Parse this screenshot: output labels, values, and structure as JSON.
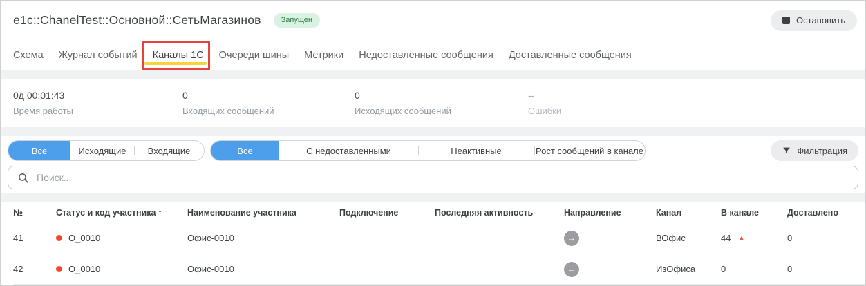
{
  "header": {
    "title": "e1c::ChanelTest::Основной::СетьМагазинов",
    "status_badge": "Запущен",
    "stop_button": "Остановить"
  },
  "tabs": [
    {
      "label": "Схема",
      "active": false
    },
    {
      "label": "Журнал событий",
      "active": false
    },
    {
      "label": "Каналы 1С",
      "active": true,
      "annotated": true
    },
    {
      "label": "Очереди шины",
      "active": false
    },
    {
      "label": "Метрики",
      "active": false
    },
    {
      "label": "Недоставленные сообщения",
      "active": false
    },
    {
      "label": "Доставленные сообщения",
      "active": false
    }
  ],
  "stats": [
    {
      "value": "0д 00:01:43",
      "label": "Время работы"
    },
    {
      "value": "0",
      "label": "Входящих сообщений"
    },
    {
      "value": "0",
      "label": "Исходящих сообщений"
    },
    {
      "value": "--",
      "label": "Ошибки",
      "muted": true
    }
  ],
  "filters": {
    "direction_segments": [
      "Все",
      "Исходящие",
      "Входящие"
    ],
    "direction_selected": "Все",
    "status_segments": [
      "Все",
      "С недоставленными",
      "Неактивные",
      "Рост сообщений в канале"
    ],
    "status_selected": "Все",
    "filter_button": "Фильтрация"
  },
  "search": {
    "placeholder": "Поиск...",
    "value": ""
  },
  "table": {
    "columns": [
      "№",
      "Статус и код участника",
      "Наименование участника",
      "Подключение",
      "Последняя активность",
      "Направление",
      "Канал",
      "В канале",
      "Доставлено"
    ],
    "sorted_by": "Статус и код участника",
    "sort_direction": "asc",
    "rows": [
      {
        "num": "41",
        "code": "О_0010",
        "name": "Офис-0010",
        "connection": "",
        "last_activity": "",
        "direction": "outgoing",
        "channel": "ВОфис",
        "in_channel": "44",
        "trend": "up",
        "delivered": "0"
      },
      {
        "num": "42",
        "code": "О_0010",
        "name": "Офис-0010",
        "connection": "",
        "last_activity": "",
        "direction": "incoming",
        "channel": "ИзОфиса",
        "in_channel": "0",
        "trend": "",
        "delivered": "0"
      }
    ]
  },
  "icons": {
    "sort_up": "↑",
    "trend_up": "▲",
    "arrow_right": "→",
    "arrow_left": "←"
  },
  "colors": {
    "accent_blue": "#4d9eeb",
    "tab_underline_yellow": "#fdd234",
    "annotation_red": "#e8423d",
    "badge_green_bg": "#d9f2e2",
    "badge_green_text": "#2e7d4b",
    "status_dot_red": "#f8442c",
    "trend_red": "#e25a3c"
  }
}
